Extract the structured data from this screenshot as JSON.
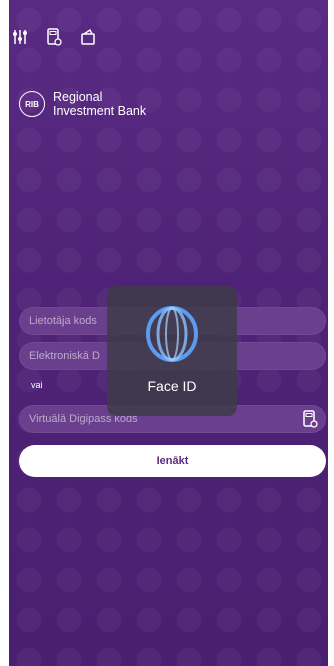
{
  "toolbar": {
    "icons": [
      "settings-sliders-icon",
      "digipass-icon",
      "wallet-icon"
    ]
  },
  "bank": {
    "badge": "RIB",
    "name_line1": "Regional",
    "name_line2": "Investment Bank"
  },
  "login": {
    "username_placeholder": "Lietotāja kods",
    "elektroniska_placeholder": "Elektroniskā D",
    "or_label": "vai",
    "virtual_placeholder": "Virtuālā Digipass kods",
    "submit_label": "Ienākt"
  },
  "overlay": {
    "label": "Face ID"
  },
  "colors": {
    "accent": "#5b2a84",
    "background": "#4e2276",
    "button": "#ffffff"
  }
}
